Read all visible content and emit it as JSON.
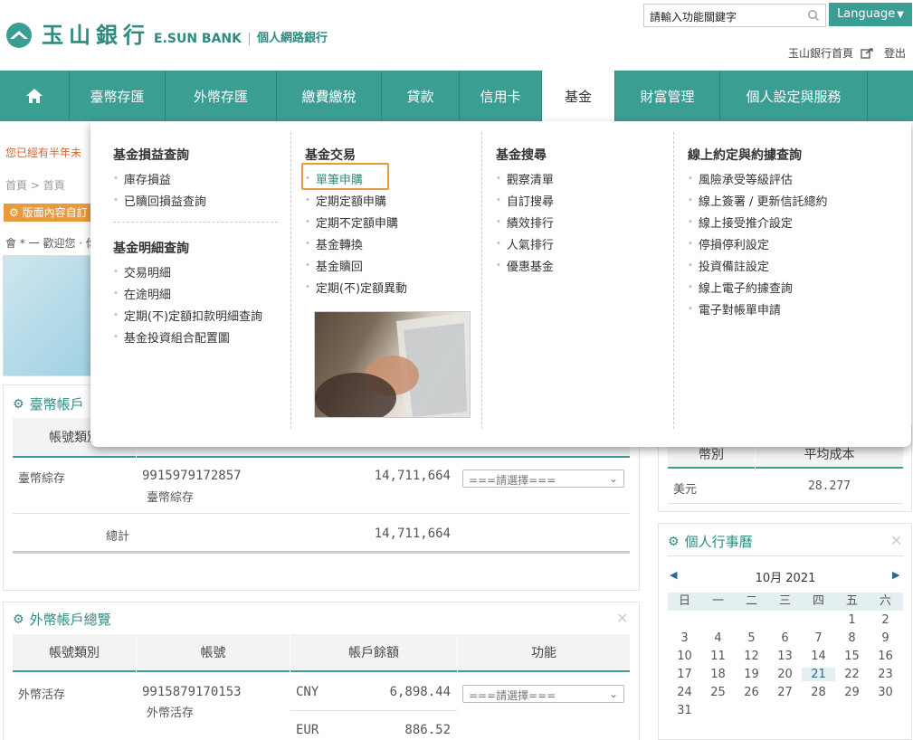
{
  "header": {
    "logo_cn": "玉山銀行",
    "logo_en": "E.SUN BANK",
    "logo_sub": "個人網路銀行",
    "search_placeholder": "請輸入功能關鍵字",
    "language": "Language",
    "home_link": "玉山銀行首頁",
    "logout": "登出"
  },
  "nav": {
    "items": [
      "臺幣存匯",
      "外幣存匯",
      "繳費繳稅",
      "貸款",
      "信用卡",
      "基金",
      "財富管理",
      "個人設定與服務"
    ],
    "active": "基金"
  },
  "background": {
    "warning": "您已經有半年未",
    "breadcrumb": "首頁 > 首頁",
    "tag": "版面內容自訂",
    "welcome": "會 * 一  歡迎您 · 你"
  },
  "twd_panel": {
    "title": "臺幣帳戶",
    "col_type": "帳號類別",
    "row_type": "臺幣綜存",
    "account_no": "9915979172857",
    "account_sub": "臺幣綜存",
    "balance": "14,711,664",
    "select": "===請選擇===",
    "total_label": "總計",
    "total_value": "14,711,664"
  },
  "fx_panel": {
    "title": "外幣帳戶總覽",
    "headers": [
      "帳號類別",
      "帳號",
      "帳戶餘額",
      "功能"
    ],
    "row_type": "外幣活存",
    "account_no": "9915879170153",
    "account_sub": "外幣活存",
    "rows": [
      {
        "currency": "CNY",
        "amount": "6,898.44"
      },
      {
        "currency": "EUR",
        "amount": "886.52"
      }
    ],
    "select": "===請選擇==="
  },
  "cost_panel": {
    "headers": [
      "幣別",
      "平均成本"
    ],
    "currency": "美元",
    "avg_cost": "28.277"
  },
  "calendar": {
    "title": "個人行事曆",
    "month": "10月 2021",
    "weekdays": [
      "日",
      "一",
      "二",
      "三",
      "四",
      "五",
      "六"
    ],
    "weeks": [
      [
        "",
        "",
        "",
        "",
        "",
        "1",
        "2"
      ],
      [
        "3",
        "4",
        "5",
        "6",
        "7",
        "8",
        "9"
      ],
      [
        "10",
        "11",
        "12",
        "13",
        "14",
        "15",
        "16"
      ],
      [
        "17",
        "18",
        "19",
        "20",
        "21",
        "22",
        "23"
      ],
      [
        "24",
        "25",
        "26",
        "27",
        "28",
        "29",
        "30"
      ],
      [
        "31",
        "",
        "",
        "",
        "",
        "",
        ""
      ]
    ],
    "today": "21"
  },
  "menu": {
    "col1": {
      "head1": "基金損益查詢",
      "links1": [
        "庫存損益",
        "已贖回損益查詢"
      ],
      "head2": "基金明細查詢",
      "links2": [
        "交易明細",
        "在途明細",
        "定期(不)定額扣款明細查詢",
        "基金投資組合配置圖"
      ]
    },
    "col2": {
      "head": "基金交易",
      "links": [
        "單筆申購",
        "定期定額申購",
        "定期不定額申購",
        "基金轉換",
        "基金贖回",
        "定期(不)定額異動"
      ]
    },
    "col3": {
      "head": "基金搜尋",
      "links": [
        "觀察清單",
        "自訂搜尋",
        "績效排行",
        "人氣排行",
        "優惠基金"
      ]
    },
    "col4": {
      "head": "線上約定與約據查詢",
      "links": [
        "風險承受等級評估",
        "線上簽署 / 更新信託總約",
        "線上接受推介設定",
        "停損停利設定",
        "投資備註設定",
        "線上電子約據查詢",
        "電子對帳單申請"
      ]
    }
  },
  "colors": {
    "brand": "#3b9e93",
    "highlight": "#e99a3c"
  }
}
